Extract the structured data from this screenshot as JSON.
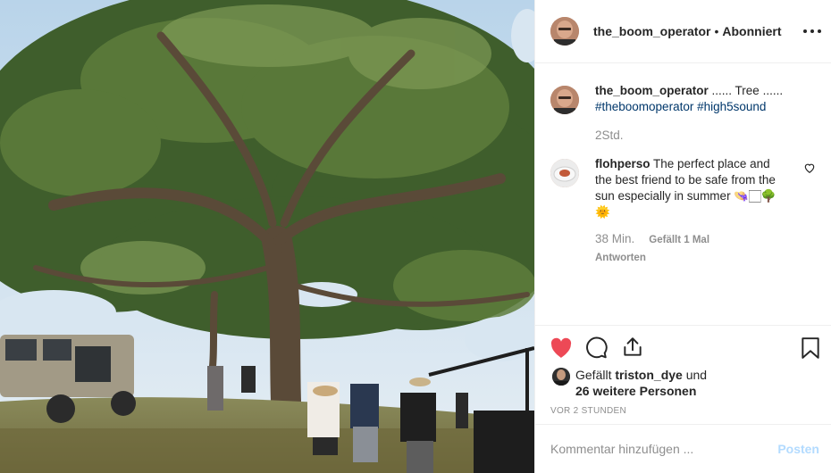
{
  "post": {
    "image_alt": "Large tree with film crew and off-road vehicle",
    "author": {
      "username": "the_boom_operator",
      "separator": "•",
      "follow_status": "Abonniert"
    }
  },
  "caption": {
    "username": "the_boom_operator",
    "text": "...... Tree ......",
    "hashtags": "#theboomoperator #high5sound",
    "time": "2Std."
  },
  "comment": {
    "username": "flohperso",
    "text": "The perfect place and the best friend to be safe from the sun especially in summer 👒🏻🌳🌞",
    "time": "38 Min.",
    "likes": "Gefällt 1 Mal",
    "reply_label": "Antworten"
  },
  "likes": {
    "prefix": "Gefällt",
    "first_user": "triston_dye",
    "connector": "und",
    "others": "26 weitere Personen"
  },
  "timestamp": "VOR 2 STUNDEN",
  "comment_input": {
    "placeholder": "Kommentar hinzufügen ...",
    "post_label": "Posten"
  },
  "colors": {
    "heart_liked": "#ed4956",
    "hashtag": "#00376b",
    "post_disabled": "#b3dbff",
    "muted": "#8e8e8e"
  },
  "icons": {
    "like": "heart-filled-icon",
    "comment": "speech-bubble-icon",
    "share": "share-upload-icon",
    "save": "bookmark-icon",
    "more": "ellipsis-icon",
    "comment_like": "heart-outline-icon"
  }
}
